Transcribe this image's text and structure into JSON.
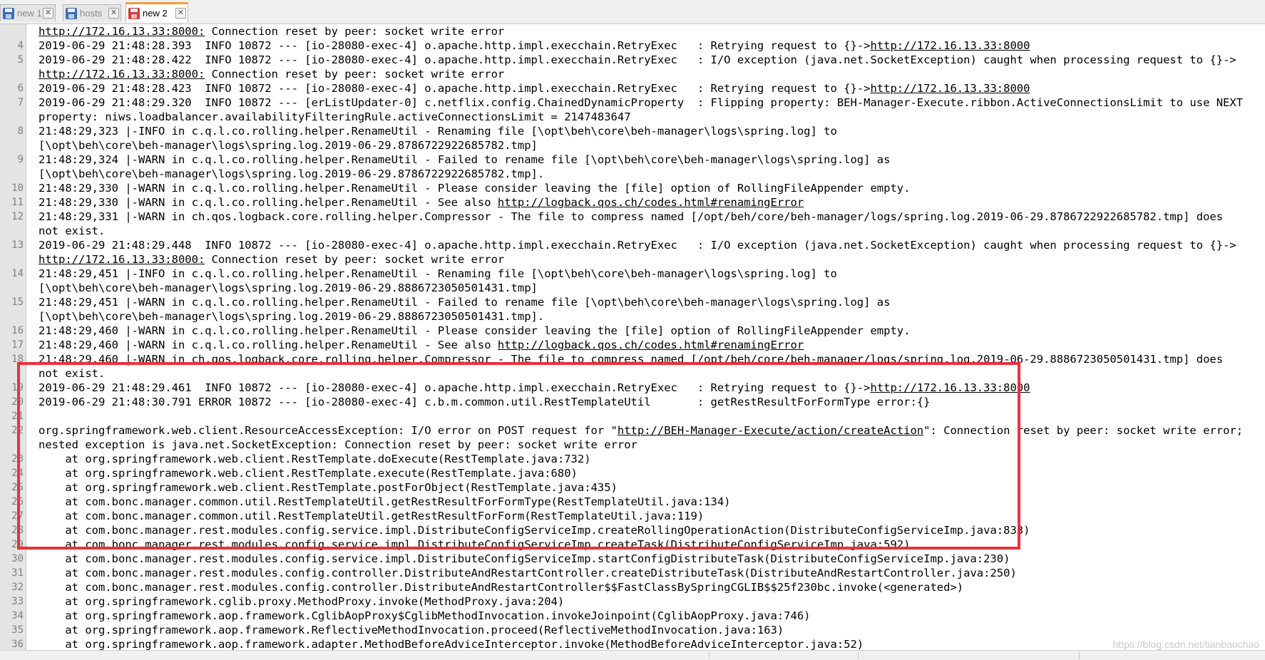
{
  "tabs": [
    {
      "label": "new 1",
      "active": false,
      "icon": "floppy-icon"
    },
    {
      "label": "hosts",
      "active": false,
      "icon": "floppy-icon"
    },
    {
      "label": "new 2",
      "active": true,
      "icon": "floppy-red-icon"
    }
  ],
  "lines": [
    {
      "num": "",
      "segments": [
        {
          "t": "http://172.16.13.33:8000:",
          "u": true
        },
        {
          "t": " Connection reset by peer: socket write error"
        }
      ]
    },
    {
      "num": "4",
      "segments": [
        {
          "t": "2019-06-29 21:48:28.393  INFO 10872 --- [io-28080-exec-4] o.apache.http.impl.execchain.RetryExec   : Retrying request to {}->"
        },
        {
          "t": "http://172.16.13.33:8000",
          "u": true
        }
      ]
    },
    {
      "num": "5",
      "segments": [
        {
          "t": "2019-06-29 21:48:28.422  INFO 10872 --- [io-28080-exec-4] o.apache.http.impl.execchain.RetryExec   : I/O exception (java.net.SocketException) caught when processing request to {}->"
        }
      ]
    },
    {
      "num": "",
      "segments": [
        {
          "t": "http://172.16.13.33:8000:",
          "u": true
        },
        {
          "t": " Connection reset by peer: socket write error"
        }
      ]
    },
    {
      "num": "6",
      "segments": [
        {
          "t": "2019-06-29 21:48:28.423  INFO 10872 --- [io-28080-exec-4] o.apache.http.impl.execchain.RetryExec   : Retrying request to {}->"
        },
        {
          "t": "http://172.16.13.33:8000",
          "u": true
        }
      ]
    },
    {
      "num": "7",
      "segments": [
        {
          "t": "2019-06-29 21:48:29.320  INFO 10872 --- [erListUpdater-0] c.netflix.config.ChainedDynamicProperty  : Flipping property: BEH-Manager-Execute.ribbon.ActiveConnectionsLimit to use NEXT"
        }
      ]
    },
    {
      "num": "",
      "segments": [
        {
          "t": "property: niws.loadbalancer.availabilityFilteringRule.activeConnectionsLimit = 2147483647"
        }
      ]
    },
    {
      "num": "8",
      "segments": [
        {
          "t": "21:48:29,323 |-INFO in c.q.l.co.rolling.helper.RenameUtil - Renaming file [\\opt\\beh\\core\\beh-manager\\logs\\spring.log] to"
        }
      ]
    },
    {
      "num": "",
      "segments": [
        {
          "t": "[\\opt\\beh\\core\\beh-manager\\logs\\spring.log.2019-06-29.8786722922685782.tmp]"
        }
      ]
    },
    {
      "num": "9",
      "segments": [
        {
          "t": "21:48:29,324 |-WARN in c.q.l.co.rolling.helper.RenameUtil - Failed to rename file [\\opt\\beh\\core\\beh-manager\\logs\\spring.log] as"
        }
      ]
    },
    {
      "num": "",
      "segments": [
        {
          "t": "[\\opt\\beh\\core\\beh-manager\\logs\\spring.log.2019-06-29.8786722922685782.tmp]."
        }
      ]
    },
    {
      "num": "10",
      "segments": [
        {
          "t": "21:48:29,330 |-WARN in c.q.l.co.rolling.helper.RenameUtil - Please consider leaving the [file] option of RollingFileAppender empty."
        }
      ]
    },
    {
      "num": "11",
      "segments": [
        {
          "t": "21:48:29,330 |-WARN in c.q.l.co.rolling.helper.RenameUtil - See also "
        },
        {
          "t": "http://logback.qos.ch/codes.html#renamingError",
          "u": true
        }
      ]
    },
    {
      "num": "12",
      "segments": [
        {
          "t": "21:48:29,331 |-WARN in ch.qos.logback.core.rolling.helper.Compressor - The file to compress named [/opt/beh/core/beh-manager/logs/spring.log.2019-06-29.8786722922685782.tmp] does"
        }
      ]
    },
    {
      "num": "",
      "segments": [
        {
          "t": "not exist."
        }
      ]
    },
    {
      "num": "13",
      "segments": [
        {
          "t": "2019-06-29 21:48:29.448  INFO 10872 --- [io-28080-exec-4] o.apache.http.impl.execchain.RetryExec   : I/O exception (java.net.SocketException) caught when processing request to {}->"
        }
      ]
    },
    {
      "num": "",
      "segments": [
        {
          "t": "http://172.16.13.33:8000:",
          "u": true
        },
        {
          "t": " Connection reset by peer: socket write error"
        }
      ]
    },
    {
      "num": "14",
      "segments": [
        {
          "t": "21:48:29,451 |-INFO in c.q.l.co.rolling.helper.RenameUtil - Renaming file [\\opt\\beh\\core\\beh-manager\\logs\\spring.log] to"
        }
      ]
    },
    {
      "num": "",
      "segments": [
        {
          "t": "[\\opt\\beh\\core\\beh-manager\\logs\\spring.log.2019-06-29.8886723050501431.tmp]"
        }
      ]
    },
    {
      "num": "15",
      "segments": [
        {
          "t": "21:48:29,451 |-WARN in c.q.l.co.rolling.helper.RenameUtil - Failed to rename file [\\opt\\beh\\core\\beh-manager\\logs\\spring.log] as"
        }
      ]
    },
    {
      "num": "",
      "segments": [
        {
          "t": "[\\opt\\beh\\core\\beh-manager\\logs\\spring.log.2019-06-29.8886723050501431.tmp]."
        }
      ]
    },
    {
      "num": "16",
      "segments": [
        {
          "t": "21:48:29,460 |-WARN in c.q.l.co.rolling.helper.RenameUtil - Please consider leaving the [file] option of RollingFileAppender empty."
        }
      ]
    },
    {
      "num": "17",
      "segments": [
        {
          "t": "21:48:29,460 |-WARN in c.q.l.co.rolling.helper.RenameUtil - See also "
        },
        {
          "t": "http://logback.qos.ch/codes.html#renamingError",
          "u": true
        }
      ]
    },
    {
      "num": "18",
      "segments": [
        {
          "t": "21:48:29,460 |-WARN in ch.qos.logback.core.rolling.helper.Compressor - The file to compress named [/opt/beh/core/beh-manager/logs/spring.log.2019-06-29.8886723050501431.tmp] does"
        }
      ]
    },
    {
      "num": "",
      "segments": [
        {
          "t": "not exist."
        }
      ]
    },
    {
      "num": "19",
      "segments": [
        {
          "t": "2019-06-29 21:48:29.461  INFO 10872 --- [io-28080-exec-4] o.apache.http.impl.execchain.RetryExec   : Retrying request to {}->"
        },
        {
          "t": "http://172.16.13.33:8000",
          "u": true
        }
      ]
    },
    {
      "num": "20",
      "segments": [
        {
          "t": "2019-06-29 21:48:30.791 ERROR 10872 --- [io-28080-exec-4] c.b.m.common.util.RestTemplateUtil       : getRestResultForFormType error:{}"
        }
      ]
    },
    {
      "num": "21",
      "segments": [
        {
          "t": ""
        }
      ]
    },
    {
      "num": "22",
      "segments": [
        {
          "t": "org.springframework.web.client.ResourceAccessException: I/O error on POST request for \""
        },
        {
          "t": "http://BEH-Manager-Execute/action/createAction",
          "u": true
        },
        {
          "t": "\": Connection reset by peer: socket write error;"
        }
      ]
    },
    {
      "num": "",
      "segments": [
        {
          "t": "nested exception is java.net.SocketException: Connection reset by peer: socket write error"
        }
      ]
    },
    {
      "num": "23",
      "segments": [
        {
          "t": "    at org.springframework.web.client.RestTemplate.doExecute(RestTemplate.java:732)"
        }
      ]
    },
    {
      "num": "24",
      "segments": [
        {
          "t": "    at org.springframework.web.client.RestTemplate.execute(RestTemplate.java:680)"
        }
      ]
    },
    {
      "num": "25",
      "segments": [
        {
          "t": "    at org.springframework.web.client.RestTemplate.postForObject(RestTemplate.java:435)"
        }
      ]
    },
    {
      "num": "26",
      "segments": [
        {
          "t": "    at com.bonc.manager.common.util.RestTemplateUtil.getRestResultForFormType(RestTemplateUtil.java:134)"
        }
      ]
    },
    {
      "num": "27",
      "segments": [
        {
          "t": "    at com.bonc.manager.common.util.RestTemplateUtil.getRestResultForForm(RestTemplateUtil.java:119)"
        }
      ]
    },
    {
      "num": "28",
      "segments": [
        {
          "t": "    at com.bonc.manager.rest.modules.config.service.impl.DistributeConfigServiceImp.createRollingOperationAction(DistributeConfigServiceImp.java:833)"
        }
      ]
    },
    {
      "num": "29",
      "segments": [
        {
          "t": "    at com.bonc.manager.rest.modules.config.service.impl.DistributeConfigServiceImp.createTask(DistributeConfigServiceImp.java:592)"
        }
      ]
    },
    {
      "num": "30",
      "segments": [
        {
          "t": "    at com.bonc.manager.rest.modules.config.service.impl.DistributeConfigServiceImp.startConfigDistributeTask(DistributeConfigServiceImp.java:230)"
        }
      ]
    },
    {
      "num": "31",
      "segments": [
        {
          "t": "    at com.bonc.manager.rest.modules.config.controller.DistributeAndRestartController.createDistributeTask(DistributeAndRestartController.java:250)"
        }
      ]
    },
    {
      "num": "32",
      "segments": [
        {
          "t": "    at com.bonc.manager.rest.modules.config.controller.DistributeAndRestartController$$FastClassBySpringCGLIB$$25f230bc.invoke(<generated>)"
        }
      ]
    },
    {
      "num": "33",
      "segments": [
        {
          "t": "    at org.springframework.cglib.proxy.MethodProxy.invoke(MethodProxy.java:204)"
        }
      ]
    },
    {
      "num": "34",
      "segments": [
        {
          "t": "    at org.springframework.aop.framework.CglibAopProxy$CglibMethodInvocation.invokeJoinpoint(CglibAopProxy.java:746)"
        }
      ]
    },
    {
      "num": "35",
      "segments": [
        {
          "t": "    at org.springframework.aop.framework.ReflectiveMethodInvocation.proceed(ReflectiveMethodInvocation.java:163)"
        }
      ]
    },
    {
      "num": "36",
      "segments": [
        {
          "t": "    at org.springframework.aop.framework.adapter.MethodBeforeAdviceInterceptor.invoke(MethodBeforeAdviceInterceptor.java:52)"
        }
      ]
    }
  ],
  "watermark": "https://blog.csdn.net/tianbaochao",
  "colors": {
    "highlight": "#e9323a",
    "active_tab_accent": "#f39c39"
  }
}
